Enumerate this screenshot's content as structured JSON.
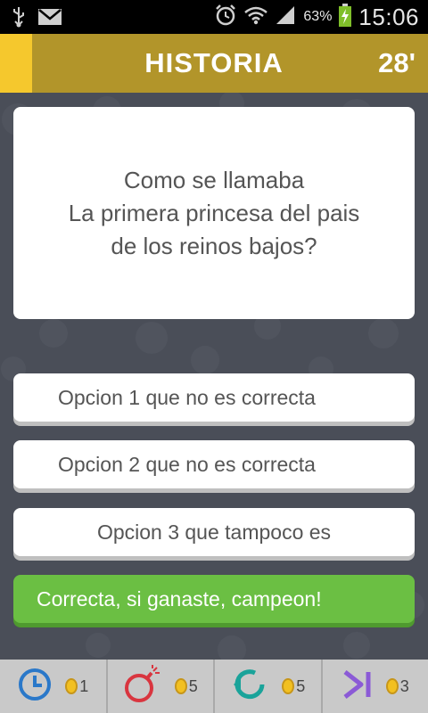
{
  "status_bar": {
    "time": "15:06",
    "battery_percent": "63%",
    "icons": [
      "usb-icon",
      "mail-icon",
      "alarm-icon",
      "wifi-icon",
      "signal-icon",
      "battery-charging-icon"
    ]
  },
  "header": {
    "title": "HISTORIA",
    "timer": "28'",
    "accent_color": "#f5c82d",
    "bar_color": "#b2952a"
  },
  "question": {
    "text": "Como se llamaba\nLa primera princesa del pais\nde los reinos bajos?"
  },
  "options": [
    {
      "label": "Opcion 1 que no es correcta",
      "state": "normal"
    },
    {
      "label": "Opcion 2 que no es correcta",
      "state": "normal"
    },
    {
      "label": "Opcion 3 que tampoco es",
      "state": "normal"
    },
    {
      "label": "Correcta, si ganaste, campeon!",
      "state": "correct"
    }
  ],
  "colors": {
    "correct": "#6bbf43",
    "background": "#4a4e58",
    "powerup_blue": "#2a78c9",
    "powerup_red": "#d9353f",
    "powerup_teal": "#1aa39a",
    "powerup_purple": "#8b5ad6",
    "coin": "#f2c021"
  },
  "powerups": [
    {
      "icon": "clock-icon",
      "cost": "1"
    },
    {
      "icon": "bomb-icon",
      "cost": "5"
    },
    {
      "icon": "refresh-icon",
      "cost": "5"
    },
    {
      "icon": "skip-icon",
      "cost": "3"
    }
  ]
}
